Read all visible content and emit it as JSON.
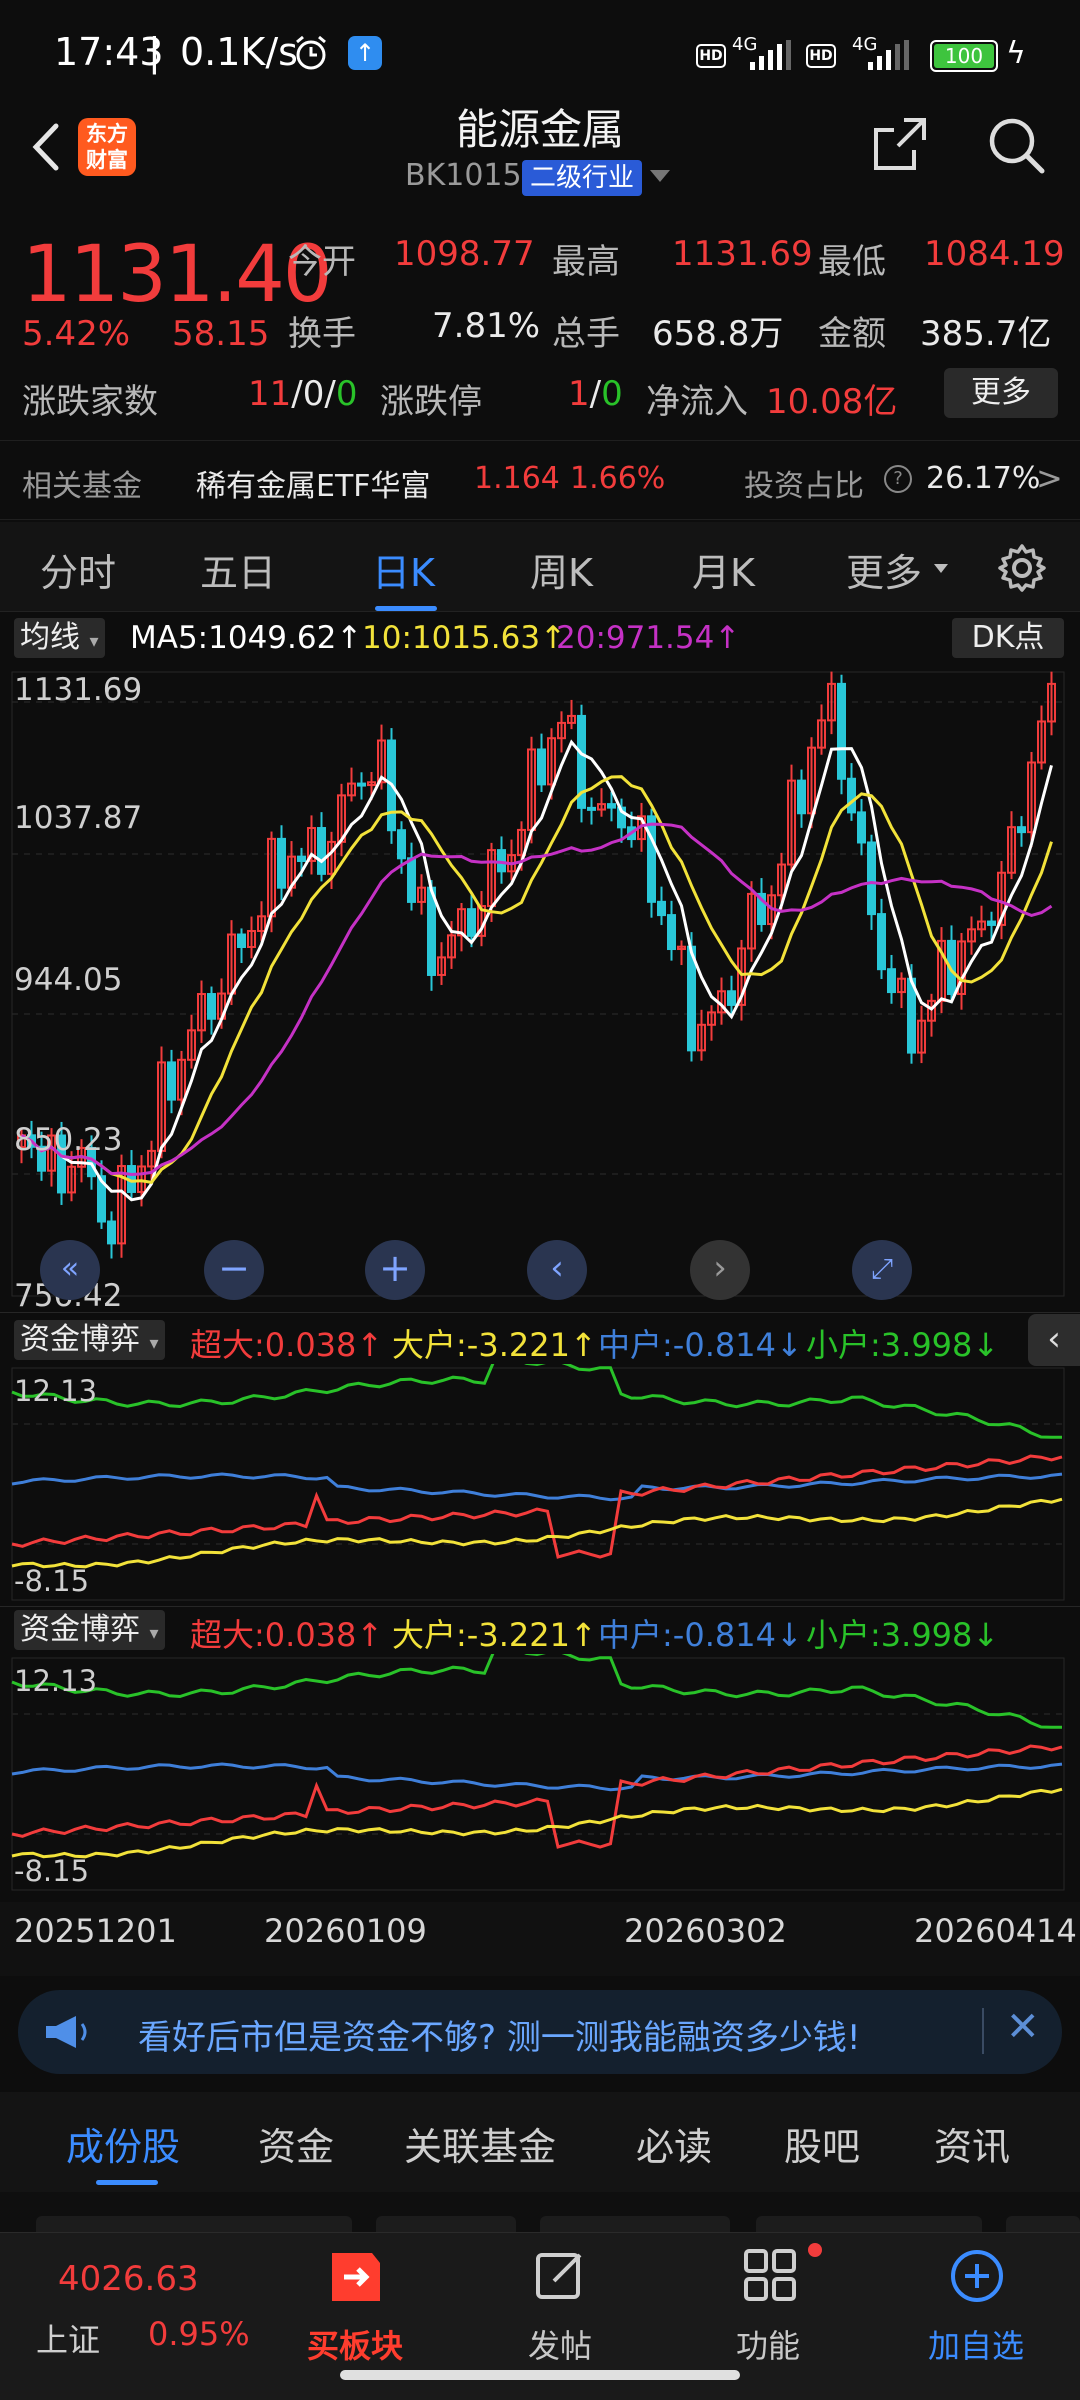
{
  "status_bar": {
    "time": "17:43",
    "speed": "0.1K/s",
    "net1": "4G",
    "net2": "4G",
    "battery": "100"
  },
  "header": {
    "logo_line1": "东方",
    "logo_line2": "财富",
    "title": "能源金属",
    "code": "BK1015",
    "tag": "二级行业"
  },
  "quote": {
    "price": "1131.40",
    "change_pct": "5.42%",
    "change": "58.15",
    "open_label": "今开",
    "open": "1098.77",
    "high_label": "最高",
    "high": "1131.69",
    "low_label": "最低",
    "low": "1084.19",
    "turnover_label": "换手",
    "turnover": "7.81%",
    "volume_label": "总手",
    "volume": "658.8万",
    "amount_label": "金额",
    "amount": "385.7亿",
    "updown_label": "涨跌家数",
    "up": "11",
    "flat": "0",
    "down": "0",
    "limit_label": "涨跌停",
    "limit_up": "1",
    "limit_down": "0",
    "netflow_label": "净流入",
    "netflow": "10.08亿",
    "more_button": "更多"
  },
  "fund_row": {
    "label": "相关基金",
    "fund_name": "稀有金属ETF华富",
    "fund_price": "1.164",
    "fund_pct": "1.66%",
    "ratio_label": "投资占比",
    "ratio": "26.17%",
    "arrow": ">"
  },
  "period_tabs": {
    "items": [
      "分时",
      "五日",
      "日K",
      "周K",
      "月K",
      "更多"
    ],
    "active": "日K"
  },
  "kline": {
    "indicator_select": "均线",
    "ma5": "MA5:1049.62",
    "ma10": "10:1015.63",
    "ma20": "20:971.54",
    "dk_button": "DK点",
    "y_labels": [
      "1131.69",
      "1037.87",
      "944.05",
      "850.23",
      "756.42"
    ]
  },
  "fund_flow": {
    "select": "资金博弈",
    "super": "超大:0.038",
    "big": "大户:-3.221",
    "mid": "中户:-0.814",
    "small": "小户:3.998",
    "y_top": "12.13",
    "y_bottom": "-8.15"
  },
  "x_labels": [
    "20251201",
    "20260109",
    "20260302",
    "20260414"
  ],
  "banner": {
    "text": "看好后市但是资金不够? 测一测我能融资多少钱!"
  },
  "content_tabs": {
    "items": [
      "成份股",
      "资金",
      "关联基金",
      "必读",
      "股吧",
      "资讯"
    ],
    "active": "成份股"
  },
  "bottom_nav": {
    "index_value": "4026.63",
    "index_name": "上证",
    "index_pct": "0.95%",
    "items": [
      "买板块",
      "发帖",
      "功能",
      "加自选"
    ]
  },
  "colors": {
    "up": "#f23c3c",
    "down": "#29c229",
    "accent": "#3b8cff",
    "ma5": "#ffffff",
    "ma10": "#f2e23a",
    "ma20": "#c531c5",
    "mid": "#3f7fd9"
  }
}
